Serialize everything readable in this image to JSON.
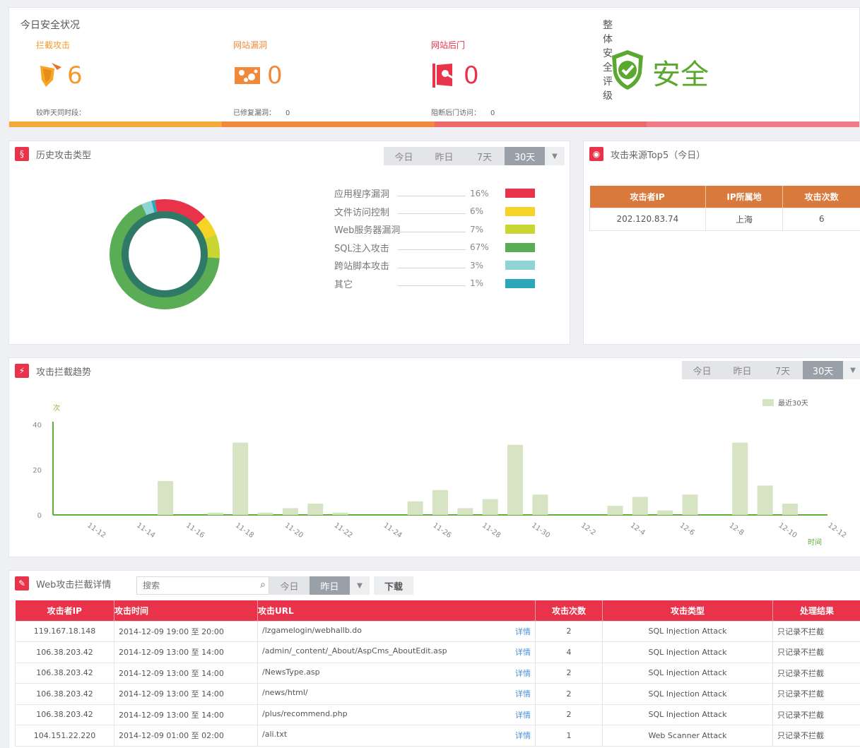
{
  "status": {
    "title": "今日安全状况",
    "overall_title": "整体安全评级",
    "overall_value": "安全",
    "stats": [
      {
        "label": "拦截攻击",
        "value": "6",
        "sub_label": "较昨天同时段：",
        "sub_value": "",
        "color": "#f39a2b"
      },
      {
        "label": "网站漏洞",
        "value": "0",
        "sub_label": "已修复漏洞：",
        "sub_value": "0",
        "color": "#f08a3a"
      },
      {
        "label": "网站后门",
        "value": "0",
        "sub_label": "阻断后门访问：",
        "sub_value": "0",
        "color": "#e8334a"
      }
    ],
    "bar_colors": [
      "#f6a93b",
      "#f08a3a",
      "#ee6a6a",
      "#f07b86"
    ]
  },
  "history": {
    "title": "历史攻击类型",
    "tabs": [
      "今日",
      "昨日",
      "7天",
      "30天"
    ],
    "active_tab": "30天",
    "legend": [
      {
        "name": "应用程序漏洞",
        "pct": "16%",
        "color": "#e8334a"
      },
      {
        "name": "文件访问控制",
        "pct": "6%",
        "color": "#f5d327"
      },
      {
        "name": "Web服务器漏洞",
        "pct": "7%",
        "color": "#c9d531"
      },
      {
        "name": "SQL注入攻击",
        "pct": "67%",
        "color": "#5aad54"
      },
      {
        "name": "跨站脚本攻击",
        "pct": "3%",
        "color": "#8ed3d6"
      },
      {
        "name": "其它",
        "pct": "1%",
        "color": "#2aa7bb"
      }
    ]
  },
  "top5": {
    "title": "攻击来源Top5（今日）",
    "headers": [
      "攻击者IP",
      "IP所属地",
      "攻击次数"
    ],
    "rows": [
      [
        "202.120.83.74",
        "上海",
        "6"
      ]
    ]
  },
  "trend": {
    "title": "攻击拦截趋势",
    "tabs": [
      "今日",
      "昨日",
      "7天",
      "30天"
    ],
    "active_tab": "30天"
  },
  "chart_data": {
    "type": "bar",
    "ylabel": "次",
    "xlabel": "时间",
    "ylim": [
      0,
      40
    ],
    "yticks": [
      0,
      20,
      40
    ],
    "series": [
      {
        "name": "最近30天"
      }
    ],
    "x_tick_labels": [
      "11-12",
      "11-14",
      "11-16",
      "11-18",
      "11-20",
      "11-22",
      "11-24",
      "11-26",
      "11-28",
      "11-30",
      "12-2",
      "12-4",
      "12-6",
      "12-8",
      "12-10",
      "12-12"
    ],
    "values": [
      0,
      0,
      0,
      0,
      15,
      0,
      1,
      32,
      1,
      3,
      5,
      1,
      0,
      0,
      6,
      11,
      3,
      7,
      31,
      9,
      0,
      0,
      4,
      8,
      2,
      9,
      0,
      32,
      13,
      5,
      0
    ]
  },
  "detail": {
    "title": "Web攻击拦截详情",
    "search_placeholder": "搜索",
    "tabs": [
      "今日",
      "昨日"
    ],
    "active_tab": "昨日",
    "download": "下载",
    "detail_link": "详情",
    "headers": [
      "攻击者IP",
      "攻击时间",
      "攻击URL",
      "攻击次数",
      "攻击类型",
      "处理结果"
    ],
    "rows": [
      [
        "119.167.18.148",
        "2014-12-09 19:00 至 20:00",
        "/lzgamelogin/webhallb.do",
        "2",
        "SQL Injection Attack",
        "只记录不拦截"
      ],
      [
        "106.38.203.42",
        "2014-12-09 13:00 至 14:00",
        "/admin/_content/_About/AspCms_AboutEdit.asp",
        "4",
        "SQL Injection Attack",
        "只记录不拦截"
      ],
      [
        "106.38.203.42",
        "2014-12-09 13:00 至 14:00",
        "/NewsType.asp",
        "2",
        "SQL Injection Attack",
        "只记录不拦截"
      ],
      [
        "106.38.203.42",
        "2014-12-09 13:00 至 14:00",
        "/news/html/",
        "2",
        "SQL Injection Attack",
        "只记录不拦截"
      ],
      [
        "106.38.203.42",
        "2014-12-09 13:00 至 14:00",
        "/plus/recommend.php",
        "2",
        "SQL Injection Attack",
        "只记录不拦截"
      ],
      [
        "104.151.22.220",
        "2014-12-09 01:00 至 02:00",
        "/ali.txt",
        "1",
        "Web Scanner Attack",
        "只记录不拦截"
      ]
    ]
  }
}
